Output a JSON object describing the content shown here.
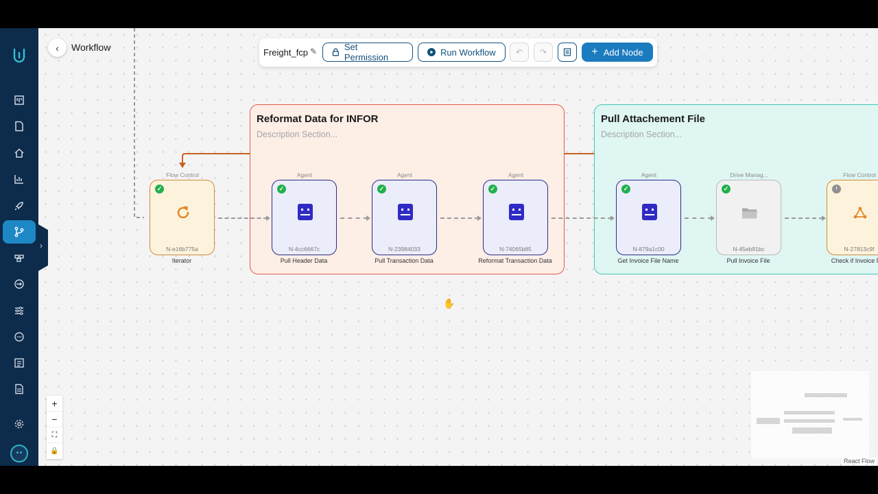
{
  "header": {
    "title": "Workflow"
  },
  "toolbar": {
    "workflow_name": "Freight_fcp",
    "set_permission_label": "Set Permission",
    "run_workflow_label": "Run Workflow",
    "add_node_label": "Add Node"
  },
  "groups": [
    {
      "title": "Reformat Data for INFOR",
      "description": "Description Section...",
      "color": "#e05a4a"
    },
    {
      "title": "Pull Attachement File",
      "description": "Description Section...",
      "color": "#3fc9b5"
    }
  ],
  "nodes": [
    {
      "tag": "Flow Control",
      "id": "N-e16b775a",
      "label": "Iterator",
      "type": "flow",
      "status": "done",
      "icon": "loop-icon"
    },
    {
      "tag": "Agent",
      "id": "N-4cc6667c",
      "label": "Pull Header Data",
      "type": "agent",
      "status": "done",
      "icon": "robot-icon"
    },
    {
      "tag": "Agent",
      "id": "N-23984033",
      "label": "Pull Transaction Data",
      "type": "agent",
      "status": "done",
      "icon": "robot-icon"
    },
    {
      "tag": "Agent",
      "id": "N-74065b85",
      "label": "Reformat Transaction Data",
      "type": "agent",
      "status": "done",
      "icon": "robot-icon"
    },
    {
      "tag": "Agent",
      "id": "N-879a1c00",
      "label": "Get Invoice File Name",
      "type": "agent",
      "status": "done",
      "icon": "robot-icon"
    },
    {
      "tag": "Drive Manag...",
      "id": "N-45eb91bc",
      "label": "Pull Invoice File",
      "type": "drive",
      "status": "done",
      "icon": "folder-icon"
    },
    {
      "tag": "Flow Control",
      "id": "N-27813c9f",
      "label": "Check if Invoice File",
      "type": "flow",
      "status": "pending",
      "icon": "branch-icon"
    }
  ],
  "footer": {
    "attribution": "React Flow"
  }
}
